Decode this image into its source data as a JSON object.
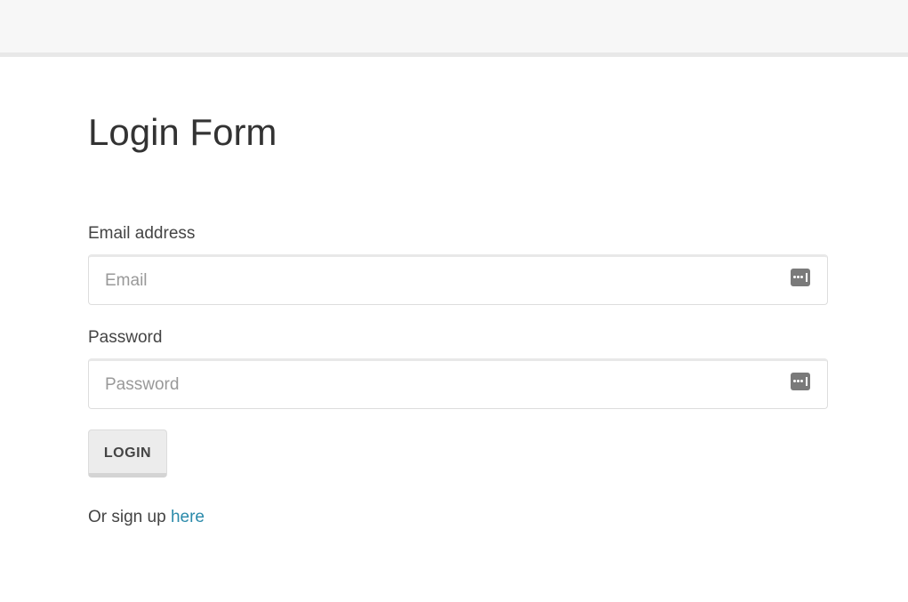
{
  "page": {
    "title": "Login Form"
  },
  "form": {
    "email": {
      "label": "Email address",
      "placeholder": "Email",
      "value": ""
    },
    "password": {
      "label": "Password",
      "placeholder": "Password",
      "value": ""
    },
    "submit_label": "LOGIN"
  },
  "signup": {
    "prefix": "Or sign up",
    "link_text": "here"
  },
  "icons": {
    "field_icon": "password-manager-key-icon"
  },
  "colors": {
    "link": "#2a8aaa",
    "topbar": "#f7f7f7"
  }
}
